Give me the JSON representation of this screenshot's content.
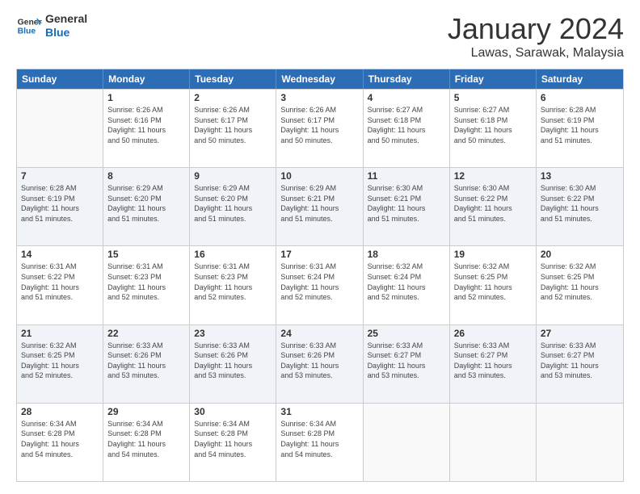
{
  "logo": {
    "line1": "General",
    "line2": "Blue"
  },
  "title": "January 2024",
  "location": "Lawas, Sarawak, Malaysia",
  "header": {
    "days": [
      "Sunday",
      "Monday",
      "Tuesday",
      "Wednesday",
      "Thursday",
      "Friday",
      "Saturday"
    ]
  },
  "weeks": [
    [
      {
        "day": "",
        "info": ""
      },
      {
        "day": "1",
        "info": "Sunrise: 6:26 AM\nSunset: 6:16 PM\nDaylight: 11 hours\nand 50 minutes."
      },
      {
        "day": "2",
        "info": "Sunrise: 6:26 AM\nSunset: 6:17 PM\nDaylight: 11 hours\nand 50 minutes."
      },
      {
        "day": "3",
        "info": "Sunrise: 6:26 AM\nSunset: 6:17 PM\nDaylight: 11 hours\nand 50 minutes."
      },
      {
        "day": "4",
        "info": "Sunrise: 6:27 AM\nSunset: 6:18 PM\nDaylight: 11 hours\nand 50 minutes."
      },
      {
        "day": "5",
        "info": "Sunrise: 6:27 AM\nSunset: 6:18 PM\nDaylight: 11 hours\nand 50 minutes."
      },
      {
        "day": "6",
        "info": "Sunrise: 6:28 AM\nSunset: 6:19 PM\nDaylight: 11 hours\nand 51 minutes."
      }
    ],
    [
      {
        "day": "7",
        "info": "Sunrise: 6:28 AM\nSunset: 6:19 PM\nDaylight: 11 hours\nand 51 minutes."
      },
      {
        "day": "8",
        "info": "Sunrise: 6:29 AM\nSunset: 6:20 PM\nDaylight: 11 hours\nand 51 minutes."
      },
      {
        "day": "9",
        "info": "Sunrise: 6:29 AM\nSunset: 6:20 PM\nDaylight: 11 hours\nand 51 minutes."
      },
      {
        "day": "10",
        "info": "Sunrise: 6:29 AM\nSunset: 6:21 PM\nDaylight: 11 hours\nand 51 minutes."
      },
      {
        "day": "11",
        "info": "Sunrise: 6:30 AM\nSunset: 6:21 PM\nDaylight: 11 hours\nand 51 minutes."
      },
      {
        "day": "12",
        "info": "Sunrise: 6:30 AM\nSunset: 6:22 PM\nDaylight: 11 hours\nand 51 minutes."
      },
      {
        "day": "13",
        "info": "Sunrise: 6:30 AM\nSunset: 6:22 PM\nDaylight: 11 hours\nand 51 minutes."
      }
    ],
    [
      {
        "day": "14",
        "info": "Sunrise: 6:31 AM\nSunset: 6:22 PM\nDaylight: 11 hours\nand 51 minutes."
      },
      {
        "day": "15",
        "info": "Sunrise: 6:31 AM\nSunset: 6:23 PM\nDaylight: 11 hours\nand 52 minutes."
      },
      {
        "day": "16",
        "info": "Sunrise: 6:31 AM\nSunset: 6:23 PM\nDaylight: 11 hours\nand 52 minutes."
      },
      {
        "day": "17",
        "info": "Sunrise: 6:31 AM\nSunset: 6:24 PM\nDaylight: 11 hours\nand 52 minutes."
      },
      {
        "day": "18",
        "info": "Sunrise: 6:32 AM\nSunset: 6:24 PM\nDaylight: 11 hours\nand 52 minutes."
      },
      {
        "day": "19",
        "info": "Sunrise: 6:32 AM\nSunset: 6:25 PM\nDaylight: 11 hours\nand 52 minutes."
      },
      {
        "day": "20",
        "info": "Sunrise: 6:32 AM\nSunset: 6:25 PM\nDaylight: 11 hours\nand 52 minutes."
      }
    ],
    [
      {
        "day": "21",
        "info": "Sunrise: 6:32 AM\nSunset: 6:25 PM\nDaylight: 11 hours\nand 52 minutes."
      },
      {
        "day": "22",
        "info": "Sunrise: 6:33 AM\nSunset: 6:26 PM\nDaylight: 11 hours\nand 53 minutes."
      },
      {
        "day": "23",
        "info": "Sunrise: 6:33 AM\nSunset: 6:26 PM\nDaylight: 11 hours\nand 53 minutes."
      },
      {
        "day": "24",
        "info": "Sunrise: 6:33 AM\nSunset: 6:26 PM\nDaylight: 11 hours\nand 53 minutes."
      },
      {
        "day": "25",
        "info": "Sunrise: 6:33 AM\nSunset: 6:27 PM\nDaylight: 11 hours\nand 53 minutes."
      },
      {
        "day": "26",
        "info": "Sunrise: 6:33 AM\nSunset: 6:27 PM\nDaylight: 11 hours\nand 53 minutes."
      },
      {
        "day": "27",
        "info": "Sunrise: 6:33 AM\nSunset: 6:27 PM\nDaylight: 11 hours\nand 53 minutes."
      }
    ],
    [
      {
        "day": "28",
        "info": "Sunrise: 6:34 AM\nSunset: 6:28 PM\nDaylight: 11 hours\nand 54 minutes."
      },
      {
        "day": "29",
        "info": "Sunrise: 6:34 AM\nSunset: 6:28 PM\nDaylight: 11 hours\nand 54 minutes."
      },
      {
        "day": "30",
        "info": "Sunrise: 6:34 AM\nSunset: 6:28 PM\nDaylight: 11 hours\nand 54 minutes."
      },
      {
        "day": "31",
        "info": "Sunrise: 6:34 AM\nSunset: 6:28 PM\nDaylight: 11 hours\nand 54 minutes."
      },
      {
        "day": "",
        "info": ""
      },
      {
        "day": "",
        "info": ""
      },
      {
        "day": "",
        "info": ""
      }
    ]
  ]
}
